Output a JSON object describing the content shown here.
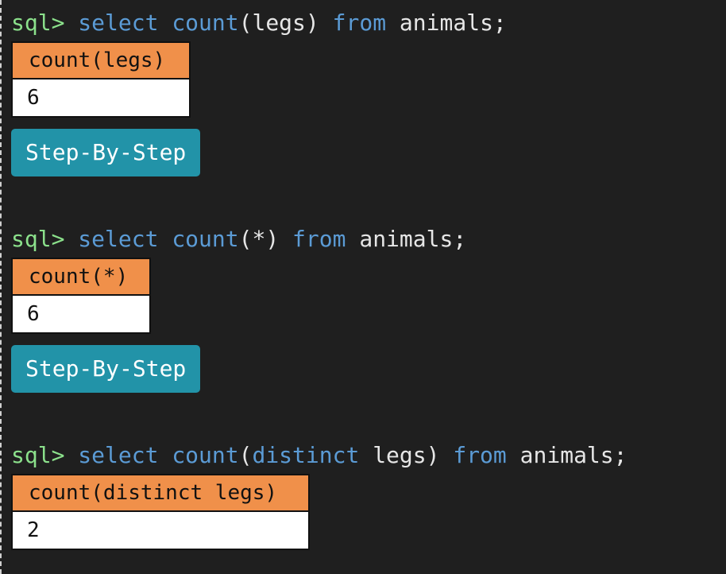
{
  "queries": [
    {
      "prompt": "sql>",
      "tokens": {
        "select": "select",
        "count": "count",
        "open_paren": "(",
        "arg": "legs",
        "close_paren": ")",
        "from": "from",
        "table": "animals;"
      },
      "result": {
        "header": "count(legs)",
        "value": "6"
      },
      "button_label": "Step-By-Step"
    },
    {
      "prompt": "sql>",
      "tokens": {
        "select": "select",
        "count": "count",
        "open_paren": "(",
        "arg": "*",
        "close_paren": ")",
        "from": "from",
        "table": "animals;"
      },
      "result": {
        "header": "count(*)",
        "value": "6"
      },
      "button_label": "Step-By-Step"
    },
    {
      "prompt": "sql>",
      "tokens": {
        "select": "select",
        "count": "count",
        "open_paren": "(",
        "distinct": "distinct",
        "arg": "legs",
        "close_paren": ")",
        "from": "from",
        "table": "animals;"
      },
      "result": {
        "header": "count(distinct legs)",
        "value": "2"
      }
    }
  ],
  "colors": {
    "background": "#1f1f1f",
    "prompt": "#8be08b",
    "keyword": "#5b9bd5",
    "header_bg": "#f0904a",
    "button_bg": "#2293a8"
  }
}
